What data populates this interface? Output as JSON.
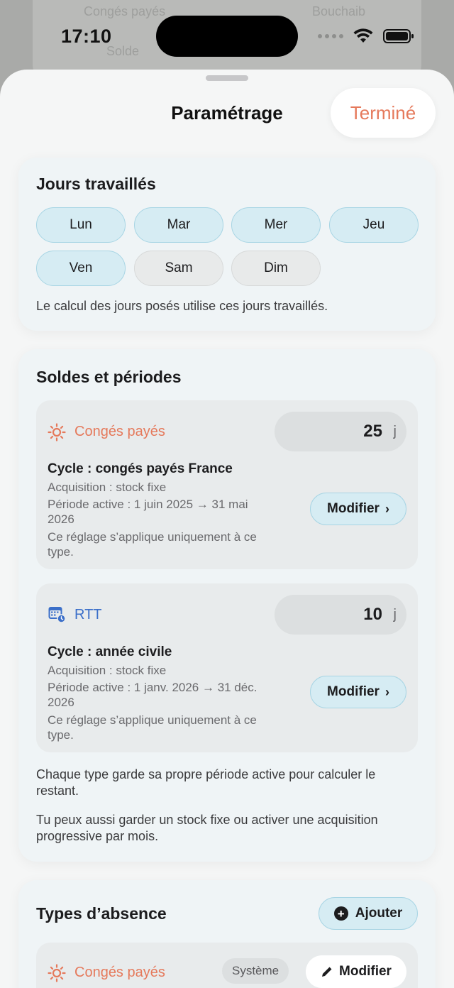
{
  "status": {
    "time": "17:10"
  },
  "background": {
    "row1_left": "Congés payés",
    "row1_right": "Bouchaib",
    "row2": "Solde"
  },
  "sheet": {
    "title": "Paramétrage",
    "done_label": "Terminé"
  },
  "workdays": {
    "title": "Jours travaillés",
    "days": [
      {
        "label": "Lun",
        "active": true
      },
      {
        "label": "Mar",
        "active": true
      },
      {
        "label": "Mer",
        "active": true
      },
      {
        "label": "Jeu",
        "active": true
      },
      {
        "label": "Ven",
        "active": true
      },
      {
        "label": "Sam",
        "active": false
      },
      {
        "label": "Dim",
        "active": false
      }
    ],
    "note": "Le calcul des jours posés utilise ces jours travaillés."
  },
  "balances": {
    "title": "Soldes et périodes",
    "types": [
      {
        "name": "Congés payés",
        "icon": "sun-icon",
        "color": "#e5795b",
        "balance": "25",
        "unit": "j",
        "cycle": "Cycle : congés payés France",
        "acquisition": "Acquisition : stock fixe",
        "period": "Période active : 1 juin 2025 → 31 mai 2026",
        "scope": "Ce réglage s’applique uniquement à ce type.",
        "modify_label": "Modifier"
      },
      {
        "name": "RTT",
        "icon": "calendar-badge-icon",
        "color": "#3b6fc9",
        "balance": "10",
        "unit": "j",
        "cycle": "Cycle : année civile",
        "acquisition": "Acquisition : stock fixe",
        "period": "Période active : 1 janv. 2026 → 31 déc. 2026",
        "scope": "Ce réglage s’applique uniquement à ce type.",
        "modify_label": "Modifier"
      }
    ],
    "note1": "Chaque type garde sa propre période active pour calculer le restant.",
    "note2": "Tu peux aussi garder un stock fixe ou activer une acquisition progressive par mois."
  },
  "absence_types": {
    "title": "Types d’absence",
    "add_label": "Ajouter",
    "items": [
      {
        "name": "Congés payés",
        "badge": "Système",
        "modify_label": "Modifier"
      }
    ]
  }
}
